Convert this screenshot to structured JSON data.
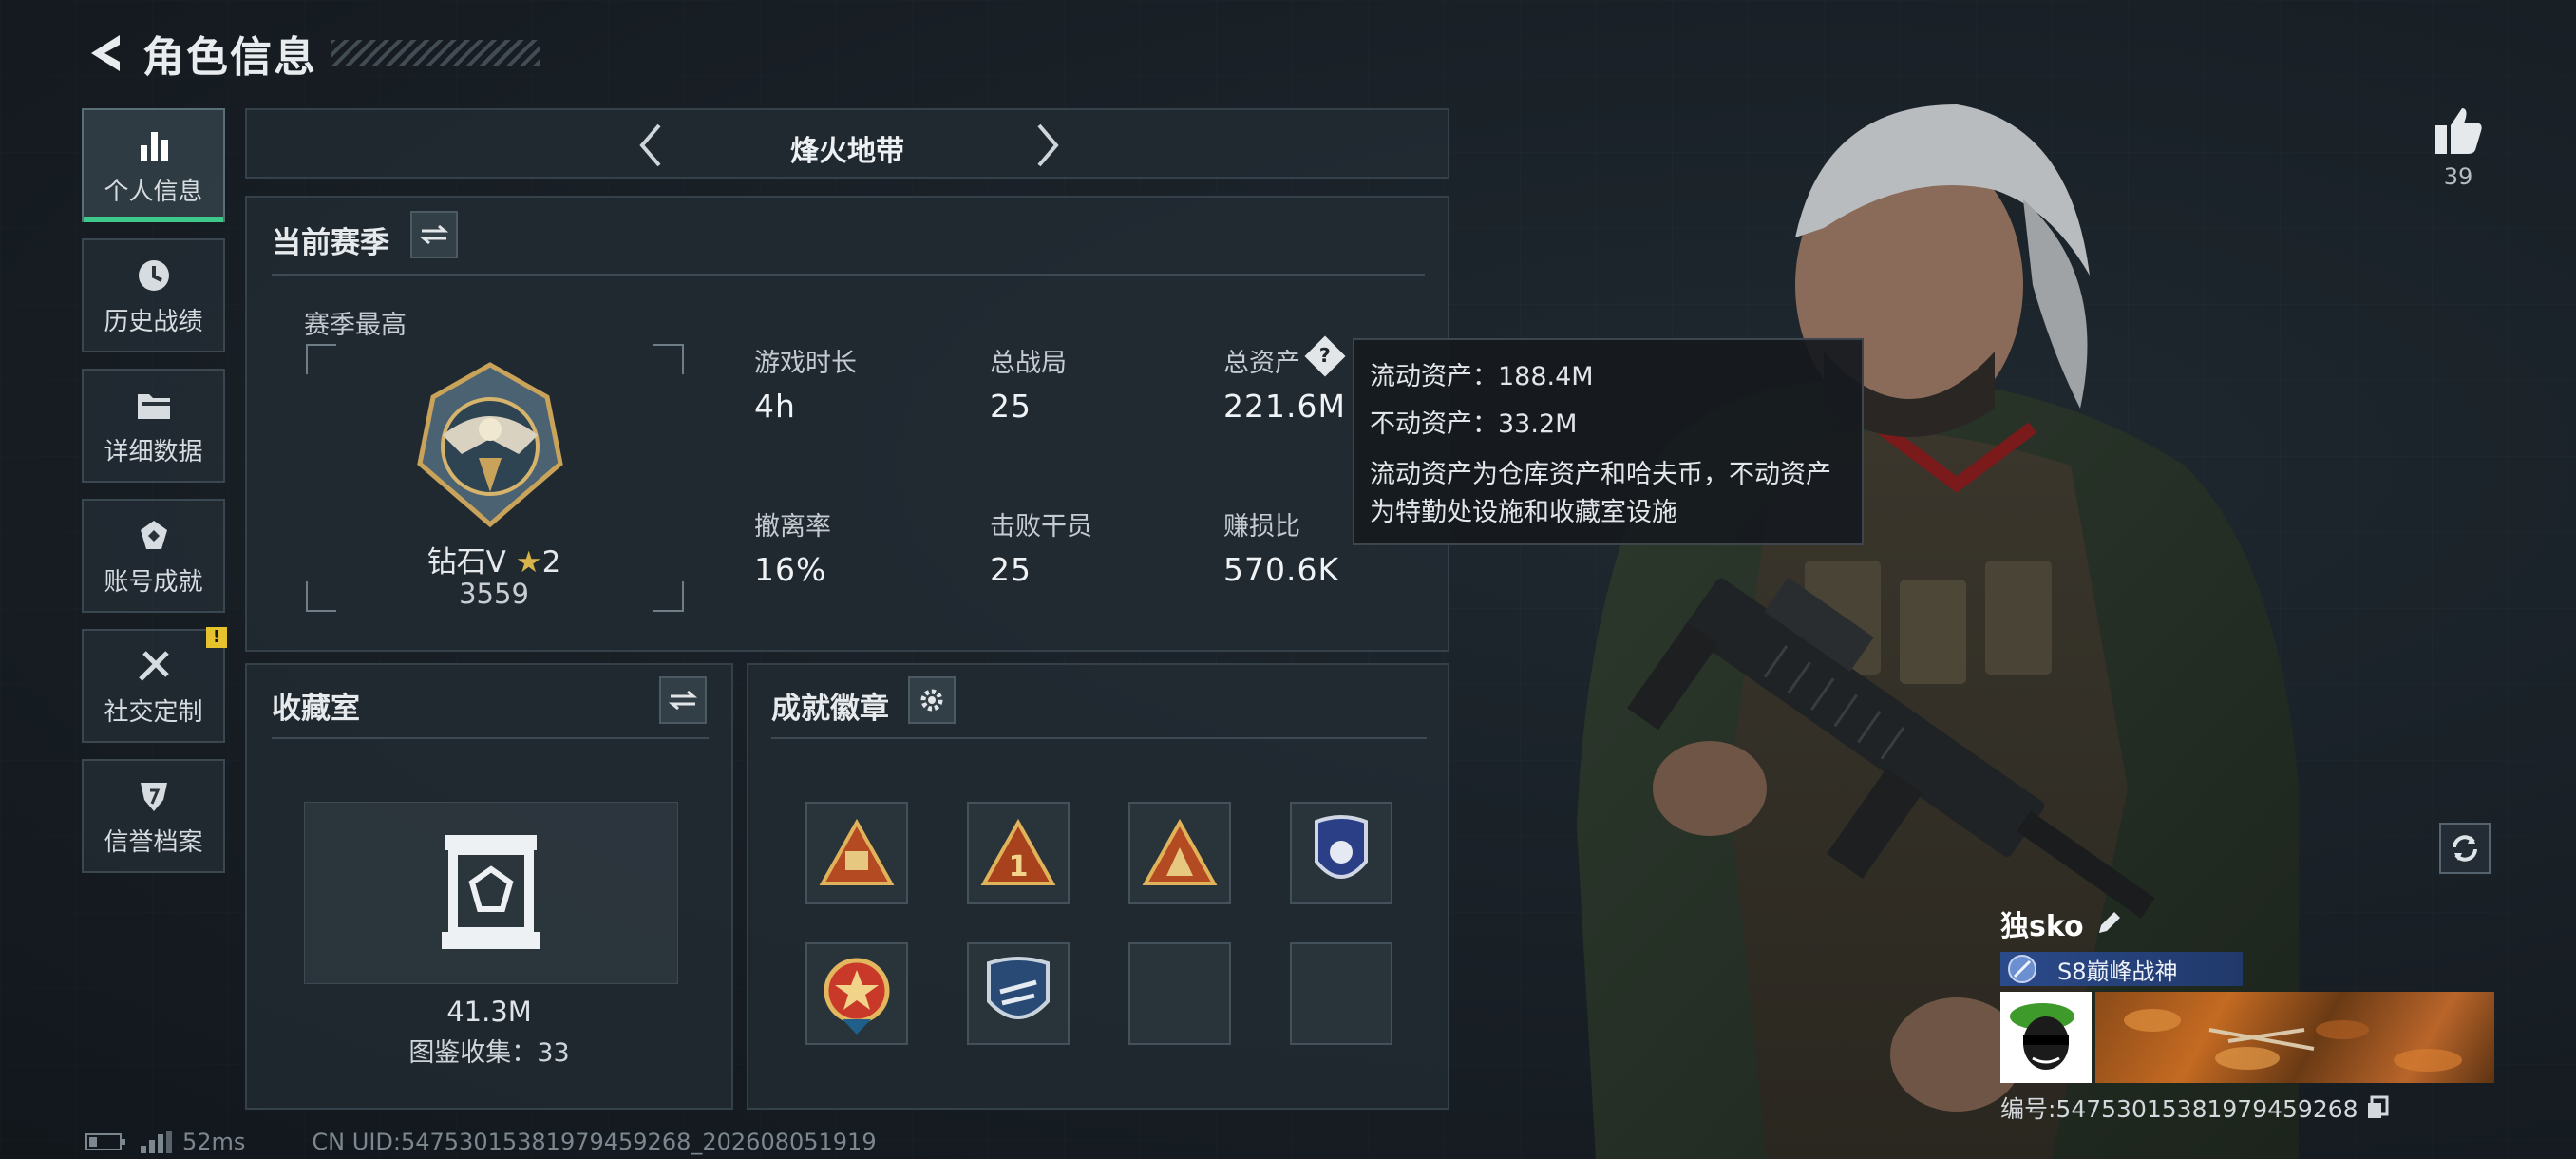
{
  "header": {
    "title": "角色信息"
  },
  "sidebar": {
    "items": [
      {
        "label": "个人信息",
        "icon": "bar-chart-icon",
        "active": true
      },
      {
        "label": "历史战绩",
        "icon": "clock-icon"
      },
      {
        "label": "详细数据",
        "icon": "folder-icon"
      },
      {
        "label": "账号成就",
        "icon": "achievement-icon"
      },
      {
        "label": "社交定制",
        "icon": "tools-icon",
        "badge": "!"
      },
      {
        "label": "信誉档案",
        "icon": "shield-icon"
      }
    ]
  },
  "mode": {
    "label": "烽火地带"
  },
  "season": {
    "title": "当前赛季",
    "best_label": "赛季最高",
    "rank_name": "钻石V",
    "rank_stars": "2",
    "rank_points": "3559",
    "stats": [
      {
        "label": "游戏时长",
        "value": "4h"
      },
      {
        "label": "总战局",
        "value": "25"
      },
      {
        "label": "总资产",
        "value": "221.6M"
      },
      {
        "label": "撤离率",
        "value": "16%"
      },
      {
        "label": "击败干员",
        "value": "25"
      },
      {
        "label": "赚损比",
        "value": "570.6K"
      }
    ]
  },
  "tooltip": {
    "liquid": "流动资产：188.4M",
    "fixed": "不动资产：33.2M",
    "note": "流动资产为仓库资产和哈夫币，不动资产为特勤处设施和收藏室设施"
  },
  "collection": {
    "title": "收藏室",
    "value": "41.3M",
    "count_text": "图鉴收集：33"
  },
  "achievements": {
    "title": "成就徽章"
  },
  "status": {
    "ping": "52ms",
    "uid": "CN UID:5475301538197945926‌8_202608051919"
  },
  "likes": {
    "count": "39"
  },
  "profile": {
    "name": "独sko",
    "title": "S8巅峰战神",
    "id_text": "编号:5475301538197945926‌8"
  },
  "colors": {
    "accent_green": "#3ec98a",
    "badge_yellow": "#e6c22d",
    "title_blue": "#2b4a8a"
  }
}
